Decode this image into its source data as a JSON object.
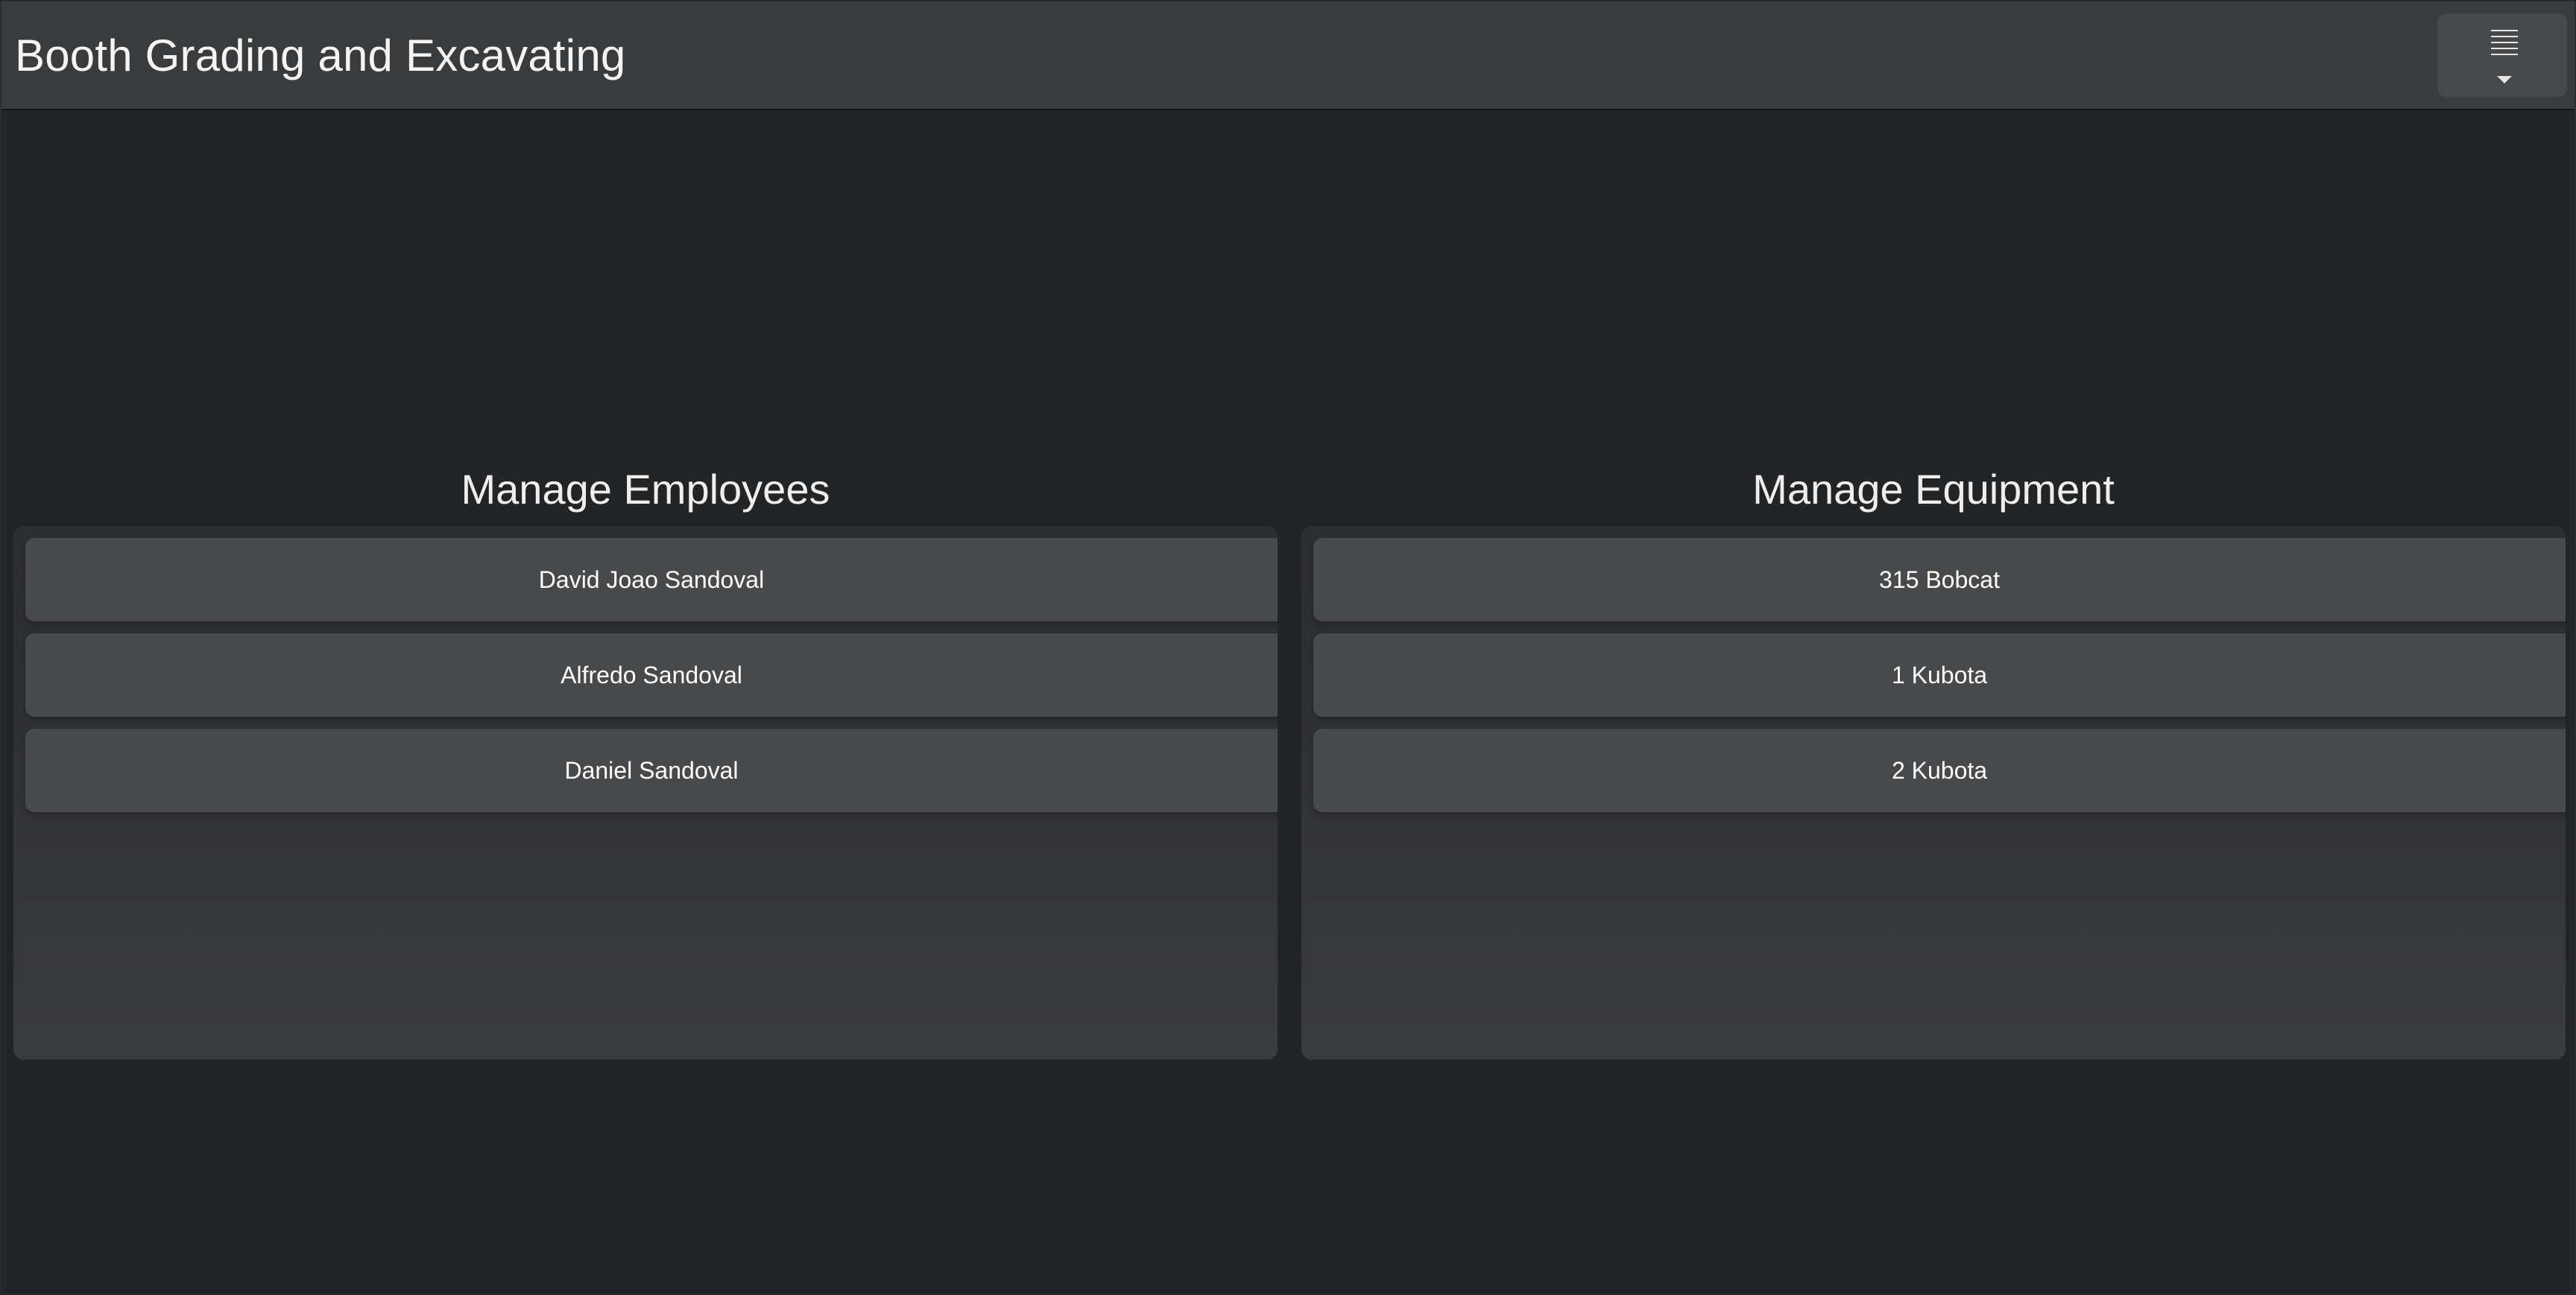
{
  "header": {
    "title": "Booth Grading and Excavating",
    "menu_icon": "hamburger-dropdown-icon"
  },
  "employees": {
    "title": "Manage Employees",
    "items": [
      "David Joao Sandoval",
      "Alfredo Sandoval",
      "Daniel Sandoval"
    ]
  },
  "equipment": {
    "title": "Manage Equipment",
    "items": [
      "315 Bobcat",
      "1 Kubota",
      "2 Kubota"
    ]
  },
  "colors": {
    "background": "#232426",
    "header": "#3a3b3d",
    "item": "#48494b",
    "text": "#ffffff"
  }
}
